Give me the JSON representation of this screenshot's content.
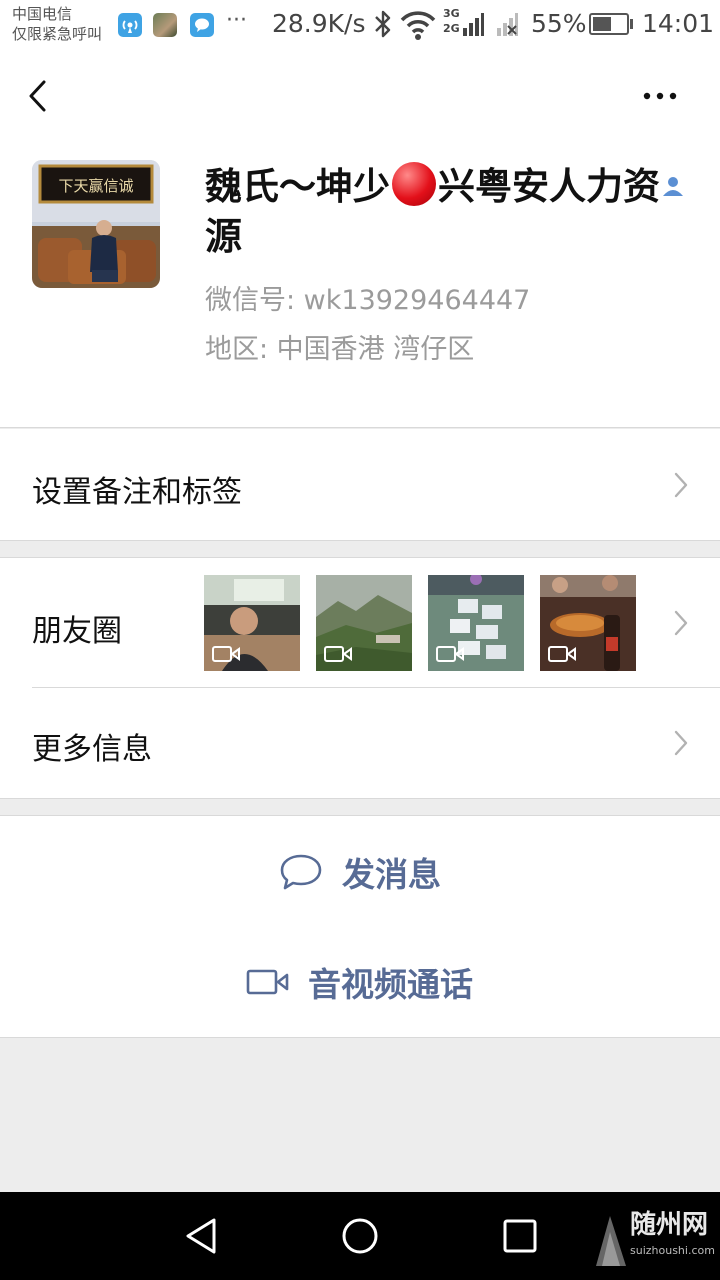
{
  "status_bar": {
    "carrier_line1": "中国电信",
    "carrier_line2": "仅限紧急呼叫",
    "overflow": "···",
    "net_speed": "28.9K/s",
    "net_type_top": "3G",
    "net_type_bottom": "2G",
    "battery_percent": "55%",
    "battery_level": 0.55,
    "time": "14:01"
  },
  "profile": {
    "name_part1": "魏氏～坤少",
    "name_part2": "兴粤安人力资源",
    "wechat_id": "微信号:  wk13929464447",
    "region": "地区:  中国香港  湾仔区",
    "avatar_plaque": "下天赢信诚"
  },
  "menu": {
    "remark": "设置备注和标签",
    "moments": "朋友圈",
    "more_info": "更多信息"
  },
  "actions": {
    "message": "发消息",
    "call": "音视频通话"
  },
  "watermark": {
    "text": "随州网",
    "url": "suizhoushi.com"
  },
  "colors": {
    "link_blue": "#576b95",
    "gray_text": "#9b9b9b",
    "background": "#ededed"
  }
}
